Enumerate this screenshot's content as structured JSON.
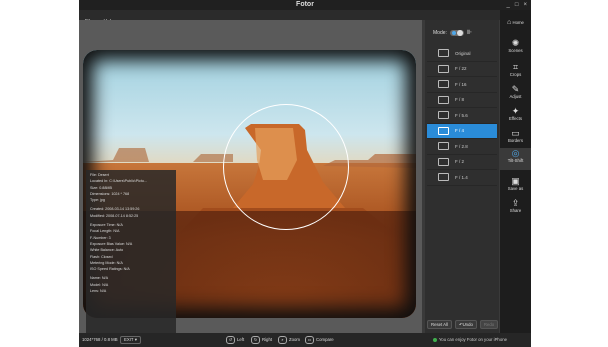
{
  "window": {
    "title": "Fotor",
    "controls": [
      "_",
      "□",
      "×"
    ]
  },
  "menu": [
    "File",
    "Help"
  ],
  "image_info": [
    "File: Desert",
    "Located In: C:\\Users\\Public\\Pictu...",
    "Size: 0.88MB",
    "Dimensions: 1024 * 768",
    "Type: jpg",
    "",
    "Created: 2008-03-14 13:59:26",
    "Modified: 2008-07-14 8:52:25",
    "",
    "Exposure Time: N/A",
    "Focal Length: N/A",
    "F-Number: 3",
    "Exposure Bias Value: N/A",
    "White Balance: Auto",
    "Flash: Closed",
    "Metering Mode: N/A",
    "ISO Speed Ratings: N/A",
    "",
    "Name: N/A",
    "Model: N/A",
    "Lens: N/A"
  ],
  "bottom": {
    "dimensions": "1024*768 / 0.8 MB",
    "exit_label": "EXIT",
    "left_label": "Left",
    "right_label": "Right",
    "zoom_label": "Zoom",
    "compare_label": "Compare",
    "promo": "You can enjoy Fotor on your iPhone"
  },
  "side_panel": {
    "mode_label": "Mode:",
    "apertures": [
      "Original",
      "F / 22",
      "F / 16",
      "F / 8",
      "F / 5.6",
      "F / 4",
      "F / 2.8",
      "F / 2",
      "F / 1.4"
    ],
    "selected_index": 5,
    "reset_label": "Reset All",
    "undo_label": "Undo",
    "redo_label": "Redo"
  },
  "toolbar": [
    {
      "label": "Home",
      "icon": "home-icon"
    },
    {
      "label": "Scenes",
      "icon": "scenes-icon"
    },
    {
      "label": "Crops",
      "icon": "crop-icon"
    },
    {
      "label": "Adjust",
      "icon": "adjust-icon"
    },
    {
      "label": "Effects",
      "icon": "effects-icon"
    },
    {
      "label": "Borders",
      "icon": "borders-icon"
    },
    {
      "label": "Tilt-Shift",
      "icon": "tilt-shift-icon"
    },
    {
      "label": "Save as",
      "icon": "save-icon"
    },
    {
      "label": "Share",
      "icon": "share-icon"
    }
  ],
  "colors": {
    "accent": "#2a8cd9",
    "background": "#3a3a3a"
  }
}
